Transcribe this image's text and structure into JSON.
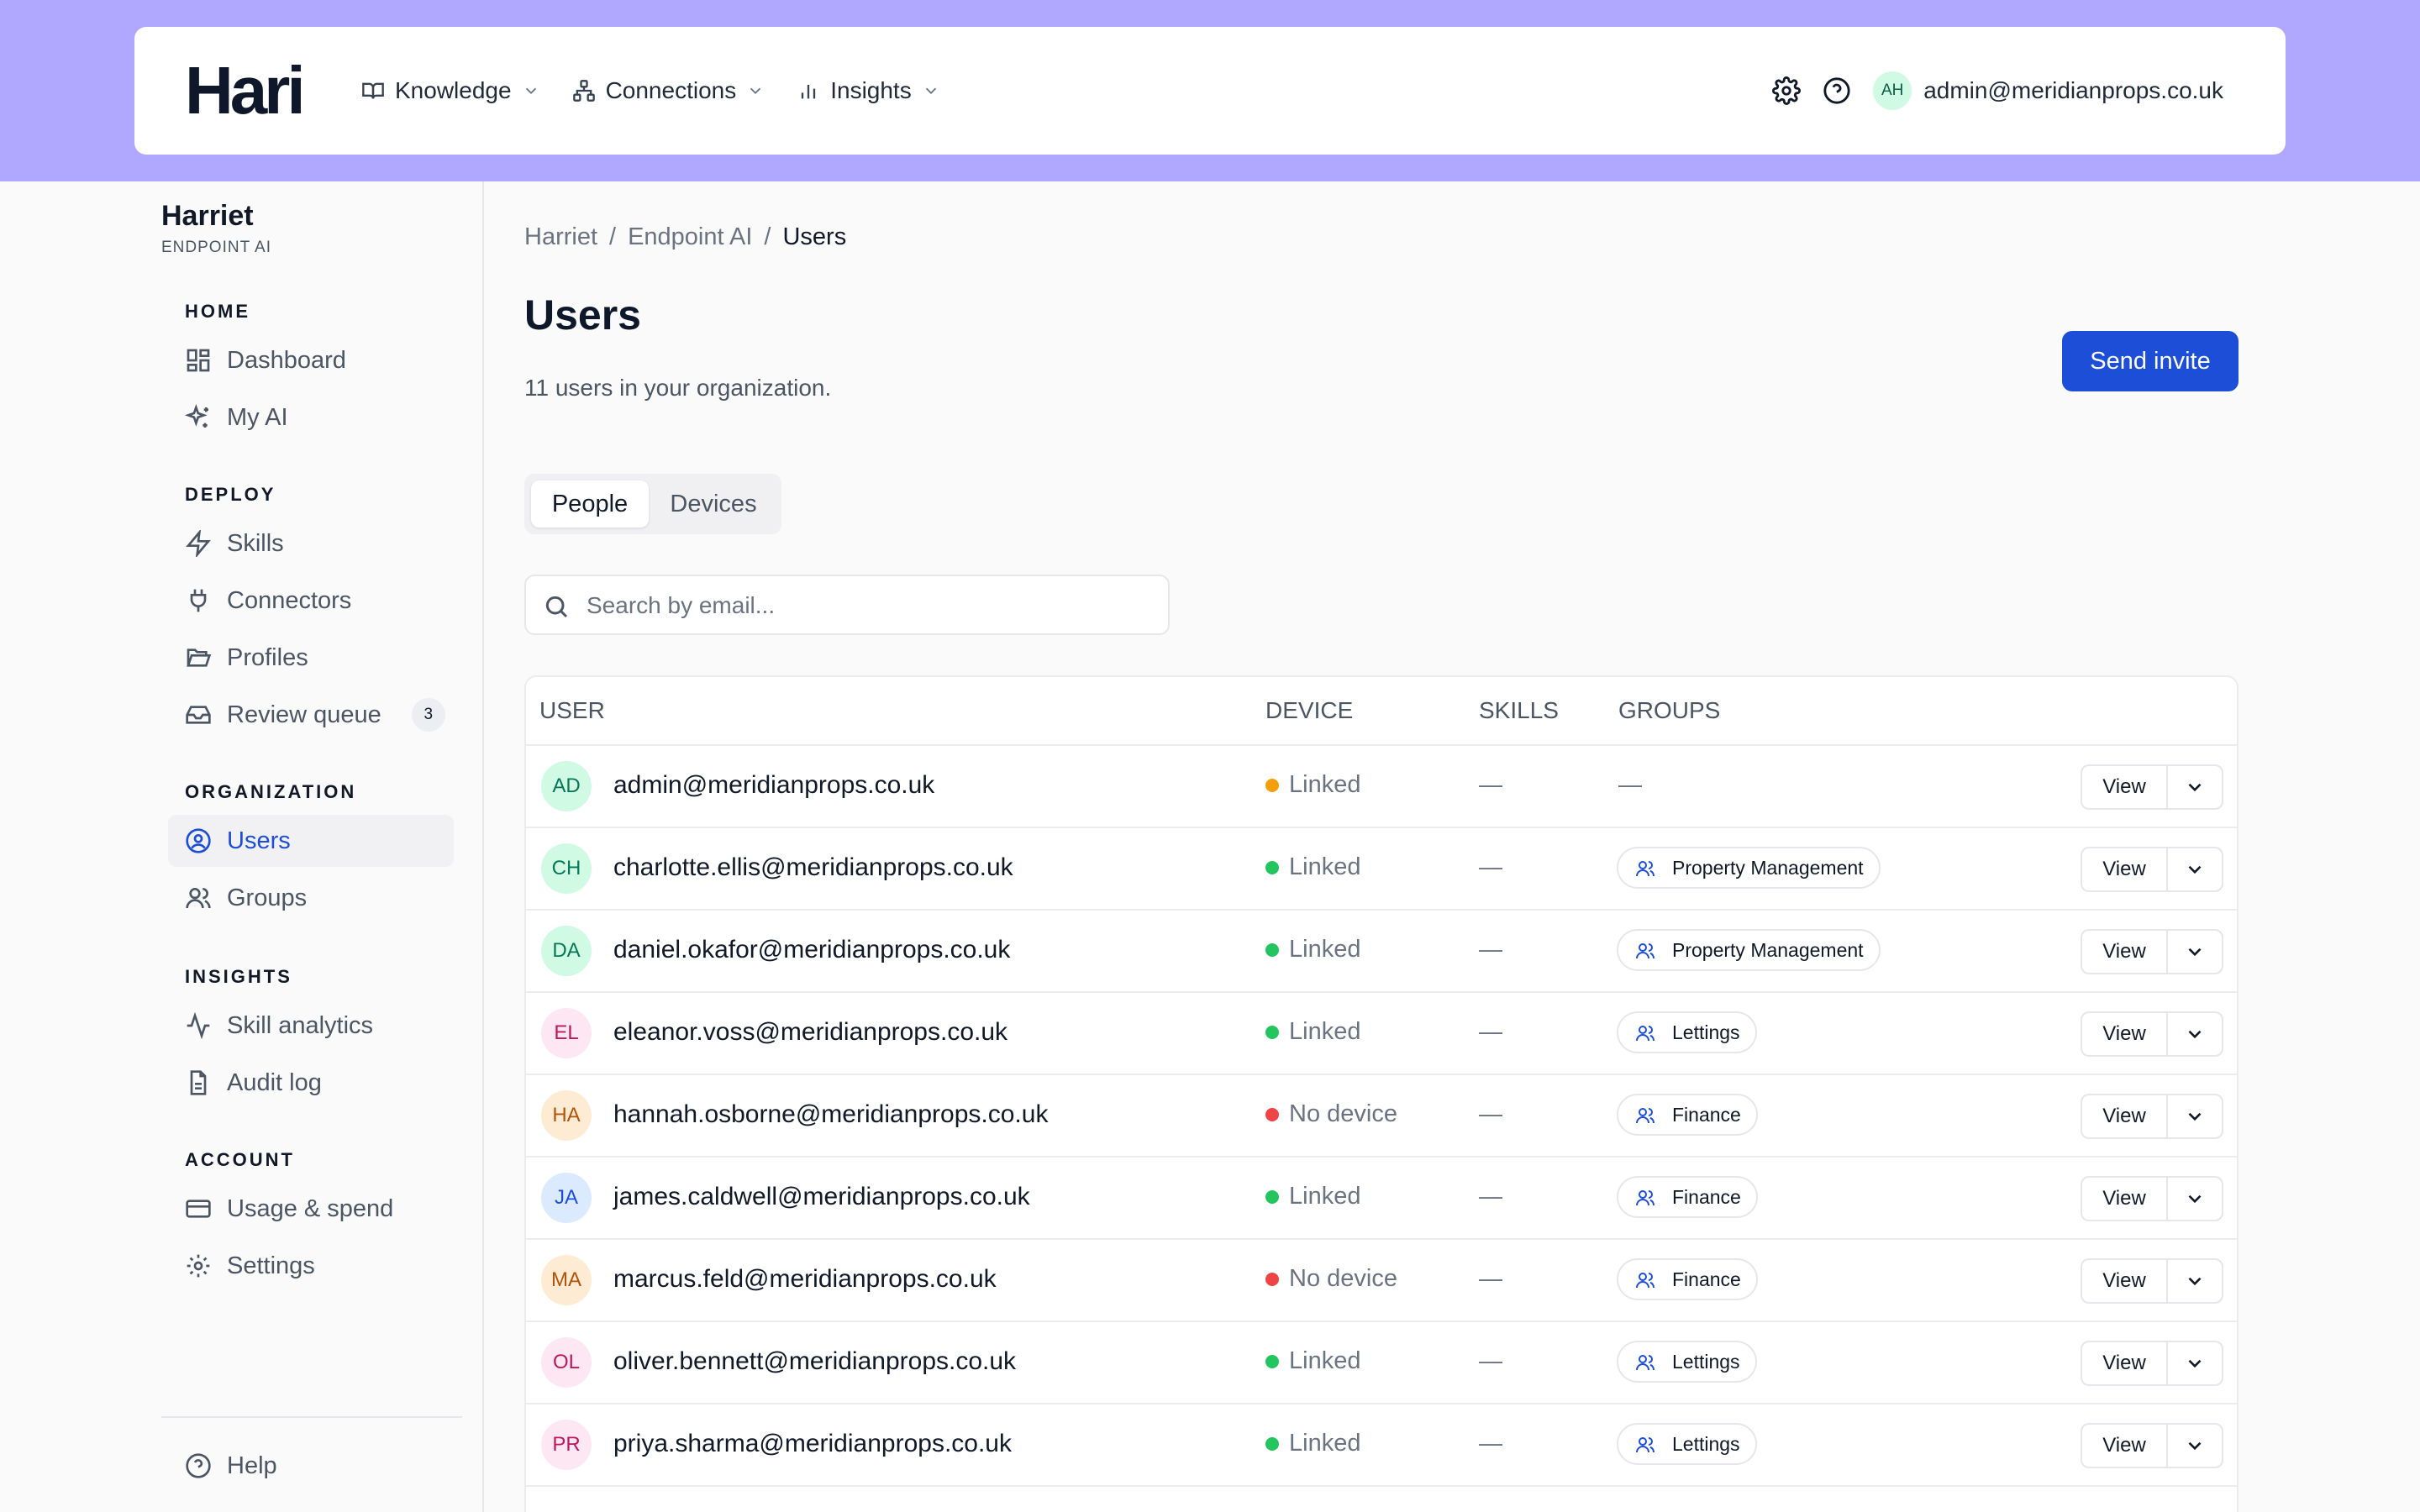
{
  "header": {
    "logo": "Hari",
    "nav": [
      {
        "label": "Knowledge",
        "icon": "book-open-icon"
      },
      {
        "label": "Connections",
        "icon": "network-icon"
      },
      {
        "label": "Insights",
        "icon": "bar-chart-icon"
      }
    ],
    "user_initials": "AH",
    "user_email": "admin@meridianprops.co.uk"
  },
  "sidebar": {
    "workspace_name": "Harriet",
    "workspace_sub": "ENDPOINT AI",
    "sections": {
      "home": "HOME",
      "deploy": "DEPLOY",
      "organization": "ORGANIZATION",
      "insights": "INSIGHTS",
      "account": "ACCOUNT"
    },
    "items": {
      "dashboard": "Dashboard",
      "my_ai": "My AI",
      "skills": "Skills",
      "connectors": "Connectors",
      "profiles": "Profiles",
      "review_queue": "Review queue",
      "review_queue_count": "3",
      "users": "Users",
      "groups": "Groups",
      "skill_analytics": "Skill analytics",
      "audit_log": "Audit log",
      "usage_spend": "Usage & spend",
      "settings": "Settings",
      "help": "Help"
    }
  },
  "main": {
    "breadcrumb": [
      "Harriet",
      "Endpoint AI",
      "Users"
    ],
    "title": "Users",
    "subtitle": "11 users in your organization.",
    "invite_button": "Send invite",
    "tabs": [
      "People",
      "Devices"
    ],
    "search_placeholder": "Search by email...",
    "columns": [
      "USER",
      "DEVICE",
      "SKILLS",
      "GROUPS"
    ],
    "rows": [
      {
        "initials": "AD",
        "email": "admin@meridianprops.co.uk",
        "device": "Linked",
        "skills": "—",
        "group": "—"
      },
      {
        "initials": "CH",
        "email": "charlotte.ellis@meridianprops.co.uk",
        "device": "Linked",
        "skills": "—",
        "group": "Property Management"
      },
      {
        "initials": "DA",
        "email": "daniel.okafor@meridianprops.co.uk",
        "device": "Linked",
        "skills": "—",
        "group": "Property Management"
      },
      {
        "initials": "EL",
        "email": "eleanor.voss@meridianprops.co.uk",
        "device": "Linked",
        "skills": "—",
        "group": "Lettings"
      },
      {
        "initials": "HA",
        "email": "hannah.osborne@meridianprops.co.uk",
        "device": "No device",
        "skills": "—",
        "group": "Finance"
      },
      {
        "initials": "JA",
        "email": "james.caldwell@meridianprops.co.uk",
        "device": "Linked",
        "skills": "—",
        "group": "Finance"
      },
      {
        "initials": "MA",
        "email": "marcus.feld@meridianprops.co.uk",
        "device": "No device",
        "skills": "—",
        "group": "Finance"
      },
      {
        "initials": "OL",
        "email": "oliver.bennett@meridianprops.co.uk",
        "device": "Linked",
        "skills": "—",
        "group": "Lettings"
      },
      {
        "initials": "PR",
        "email": "priya.sharma@meridianprops.co.uk",
        "device": "Linked",
        "skills": "—",
        "group": "Lettings"
      }
    ],
    "view_label": "View"
  },
  "colors": {
    "header_bg": "#b0a8ff",
    "accent": "#1d4ed8",
    "linked": "#22c55e",
    "no_device": "#ef4444",
    "admin_status": "#f59e0b"
  }
}
